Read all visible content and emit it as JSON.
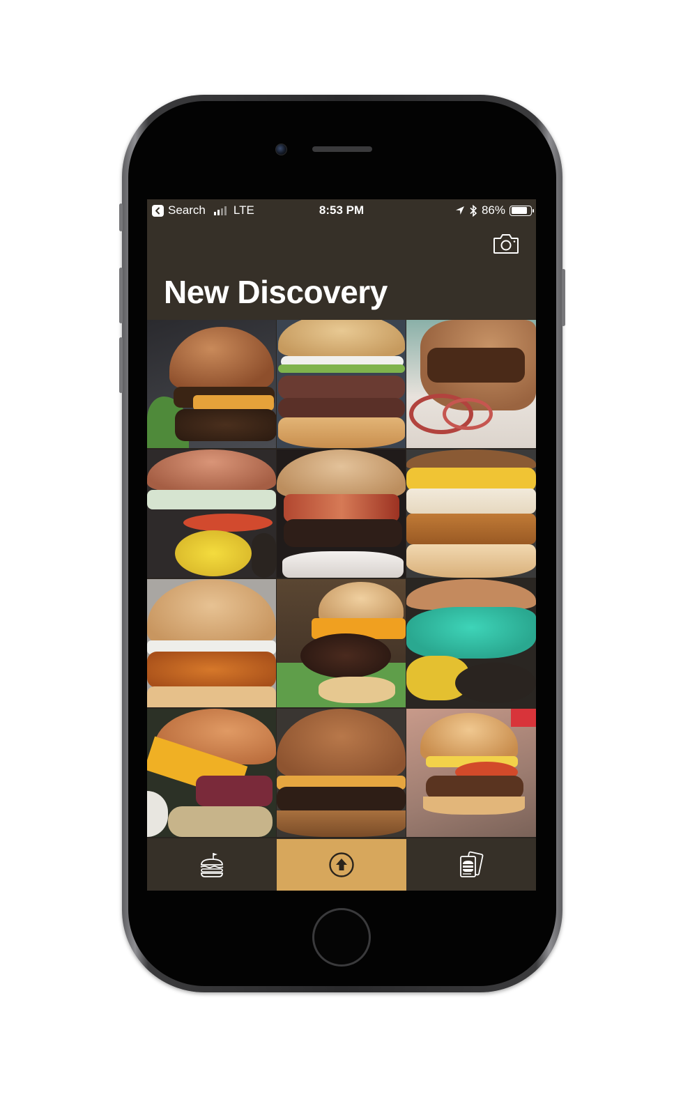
{
  "status_bar": {
    "back_app": "Search",
    "network": "LTE",
    "time": "8:53 PM",
    "battery_percent": "86%",
    "battery_level": 0.86
  },
  "header": {
    "title": "New Discovery",
    "camera_icon": "camera-icon"
  },
  "grid": {
    "photo_count": 12,
    "icon": "burger-photo"
  },
  "tab_bar": {
    "tabs": [
      {
        "icon": "burger-flag-icon",
        "selected": false
      },
      {
        "icon": "upload-arrow-icon",
        "selected": true
      },
      {
        "icon": "burger-tickets-icon",
        "selected": false
      }
    ],
    "active_color": "#d7a75c",
    "inactive_color": "#363028"
  },
  "colors": {
    "screen_background": "#363028",
    "accent": "#d7a75c",
    "text": "#ffffff"
  }
}
